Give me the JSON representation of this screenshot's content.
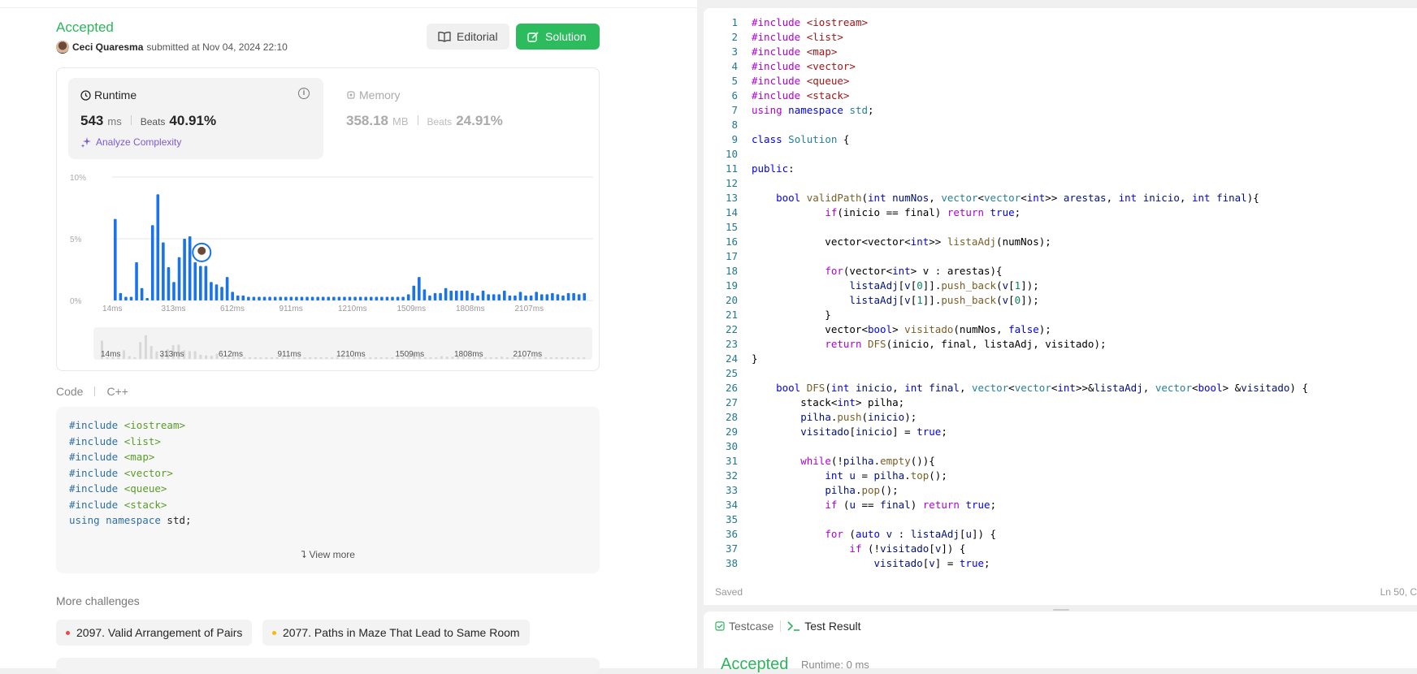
{
  "submission": {
    "status": "Accepted",
    "author_name": "Ceci Quaresma",
    "submitted_text": "submitted at Nov 04, 2024 22:10",
    "editorial_label": "Editorial",
    "solution_label": "Solution"
  },
  "runtime": {
    "label": "Runtime",
    "value": "543",
    "unit": "ms",
    "beats_label": "Beats",
    "beats_value": "40.91%",
    "analyze_label": "Analyze Complexity"
  },
  "memory": {
    "label": "Memory",
    "value": "358.18",
    "unit": "MB",
    "beats_label": "Beats",
    "beats_value": "24.91%"
  },
  "chart_data": {
    "type": "bar",
    "y_ticks": [
      "10%",
      "5%",
      "0%"
    ],
    "ylim": [
      0,
      10
    ],
    "x_tick_labels": [
      "14ms",
      "313ms",
      "612ms",
      "911ms",
      "1210ms",
      "1509ms",
      "1808ms",
      "2107ms"
    ],
    "values": [
      6.6,
      0.6,
      0.3,
      0.3,
      3.1,
      1.0,
      0.2,
      6.1,
      8.6,
      4.7,
      2.7,
      1.5,
      3.5,
      5.0,
      5.2,
      3.1,
      2.8,
      2.8,
      1.5,
      1.3,
      1.1,
      1.9,
      0.7,
      0.4,
      0.4,
      0.3,
      0.3,
      0.3,
      0.3,
      0.3,
      0.3,
      0.3,
      0.3,
      0.3,
      0.3,
      0.3,
      0.3,
      0.3,
      0.3,
      0.3,
      0.3,
      0.3,
      0.3,
      0.3,
      0.3,
      0.3,
      0.3,
      0.3,
      0.3,
      0.3,
      0.3,
      0.3,
      0.3,
      0.3,
      0.3,
      0.5,
      1.2,
      1.9,
      0.9,
      0.4,
      0.6,
      0.6,
      1.0,
      0.8,
      0.8,
      0.8,
      0.8,
      0.6,
      0.4,
      0.8,
      0.5,
      0.5,
      0.5,
      0.8,
      0.4,
      0.4,
      0.7,
      0.4,
      0.4,
      0.7,
      0.5,
      0.5,
      0.6,
      0.5,
      0.4,
      0.6,
      0.6,
      0.5,
      0.6
    ],
    "highlight_index": 15,
    "color": "#1a73e8"
  },
  "code_section": {
    "label": "Code",
    "language": "C++",
    "lines": [
      {
        "pre": "#include",
        "arg": " <iostream>"
      },
      {
        "pre": "#include",
        "arg": " <list>"
      },
      {
        "pre": "#include",
        "arg": " <map>"
      },
      {
        "pre": "#include",
        "arg": " <vector>"
      },
      {
        "pre": "#include",
        "arg": " <queue>"
      },
      {
        "pre": "#include",
        "arg": " <stack>"
      }
    ],
    "last_line": {
      "k1": "using",
      "k2": "namespace",
      "rest": " std;"
    },
    "view_more": "View more"
  },
  "more_challenges": {
    "title": "More challenges",
    "items": [
      {
        "label": "2097. Valid Arrangement of Pairs",
        "color": "#ef4743"
      },
      {
        "label": "2077. Paths in Maze That Lead to Same Room",
        "color": "#ffb800"
      }
    ]
  },
  "editor": {
    "line_numbers": [
      "1",
      "2",
      "3",
      "4",
      "5",
      "6",
      "7",
      "8",
      "9",
      "10",
      "11",
      "12",
      "13",
      "14",
      "15",
      "16",
      "17",
      "18",
      "19",
      "20",
      "21",
      "22",
      "23",
      "24",
      "25",
      "26",
      "27",
      "28",
      "29",
      "30",
      "31",
      "32",
      "33",
      "34",
      "35",
      "36",
      "37",
      "38"
    ],
    "status_saved": "Saved",
    "cursor_pos": "Ln 50, C"
  },
  "result_panel": {
    "tab_testcase": "Testcase",
    "tab_result": "Test Result",
    "status": "Accepted",
    "runtime": "Runtime: 0 ms"
  }
}
